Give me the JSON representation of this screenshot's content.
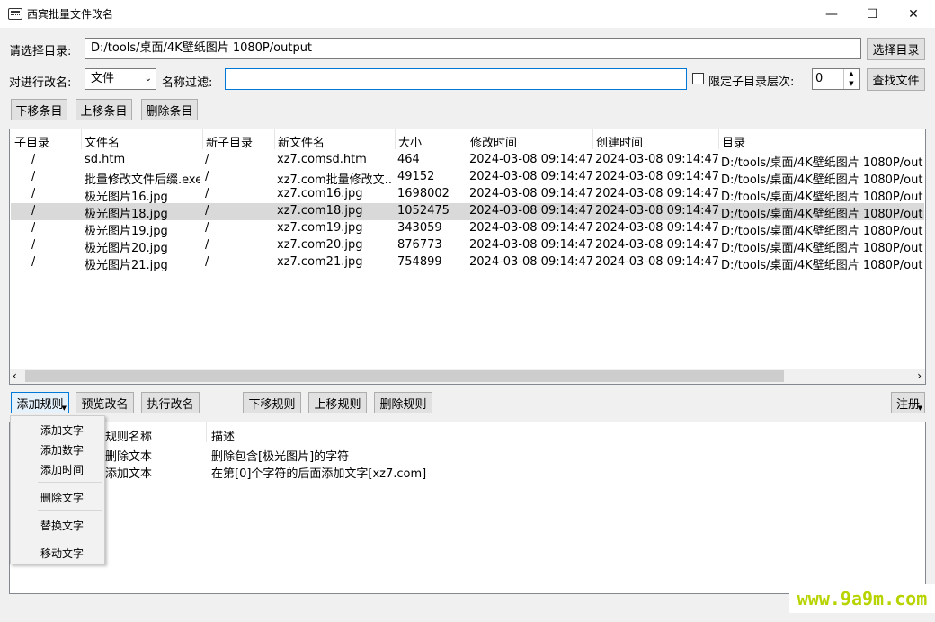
{
  "window": {
    "title": "西宾批量文件改名",
    "minimize": "—",
    "maximize": "☐",
    "close": "✕"
  },
  "toolbar": {
    "dir_label": "请选择目录:",
    "dir_value": "D:/tools/桌面/4K壁纸图片 1080P/output",
    "select_dir_button": "选择目录",
    "target_label": "对进行改名:",
    "target_value": "文件",
    "filter_label": "名称过滤:",
    "filter_value": "",
    "limit_depth_label": "限定子目录层次:",
    "limit_depth_checked": false,
    "depth_value": "0",
    "find_files_button": "查找文件",
    "move_down_button": "下移条目",
    "move_up_button": "上移条目",
    "delete_button": "删除条目"
  },
  "file_list": {
    "columns": [
      "子目录",
      "文件名",
      "新子目录",
      "新文件名",
      "大小",
      "修改时间",
      "创建时间",
      "目录"
    ],
    "rows": [
      {
        "subdir": "/",
        "name": "sd.htm",
        "new_subdir": "/",
        "new_name": "xz7.comsd.htm",
        "size": "464",
        "modified": "2024-03-08 09:14:47",
        "created": "2024-03-08 09:14:47",
        "dir": "D:/tools/桌面/4K壁纸图片 1080P/out",
        "selected": false
      },
      {
        "subdir": "/",
        "name": "批量修改文件后缀.exe",
        "new_subdir": "/",
        "new_name": "xz7.com批量修改文...",
        "size": "49152",
        "modified": "2024-03-08 09:14:47",
        "created": "2024-03-08 09:14:47",
        "dir": "D:/tools/桌面/4K壁纸图片 1080P/out",
        "selected": false
      },
      {
        "subdir": "/",
        "name": "极光图片16.jpg",
        "new_subdir": "/",
        "new_name": "xz7.com16.jpg",
        "size": "1698002",
        "modified": "2024-03-08 09:14:47",
        "created": "2024-03-08 09:14:47",
        "dir": "D:/tools/桌面/4K壁纸图片 1080P/out",
        "selected": false
      },
      {
        "subdir": "/",
        "name": "极光图片18.jpg",
        "new_subdir": "/",
        "new_name": "xz7.com18.jpg",
        "size": "1052475",
        "modified": "2024-03-08 09:14:47",
        "created": "2024-03-08 09:14:47",
        "dir": "D:/tools/桌面/4K壁纸图片 1080P/out",
        "selected": true
      },
      {
        "subdir": "/",
        "name": "极光图片19.jpg",
        "new_subdir": "/",
        "new_name": "xz7.com19.jpg",
        "size": "343059",
        "modified": "2024-03-08 09:14:47",
        "created": "2024-03-08 09:14:47",
        "dir": "D:/tools/桌面/4K壁纸图片 1080P/out",
        "selected": false
      },
      {
        "subdir": "/",
        "name": "极光图片20.jpg",
        "new_subdir": "/",
        "new_name": "xz7.com20.jpg",
        "size": "876773",
        "modified": "2024-03-08 09:14:47",
        "created": "2024-03-08 09:14:47",
        "dir": "D:/tools/桌面/4K壁纸图片 1080P/out",
        "selected": false
      },
      {
        "subdir": "/",
        "name": "极光图片21.jpg",
        "new_subdir": "/",
        "new_name": "xz7.com21.jpg",
        "size": "754899",
        "modified": "2024-03-08 09:14:47",
        "created": "2024-03-08 09:14:47",
        "dir": "D:/tools/桌面/4K壁纸图片 1080P/out",
        "selected": false
      }
    ],
    "scroll_left": "‹",
    "scroll_right": "›"
  },
  "rule_buttons": {
    "add_rule": "添加规则",
    "preview": "预览改名",
    "execute": "执行改名",
    "move_down": "下移规则",
    "move_up": "上移规则",
    "delete": "删除规则",
    "register": "注册"
  },
  "rules_list": {
    "columns": [
      "规则名称",
      "描述"
    ],
    "rows": [
      {
        "name": "删除文本",
        "desc": "删除包含[极光图片]的字符"
      },
      {
        "name": "添加文本",
        "desc": "在第[0]个字符的后面添加文字[xz7.com]"
      }
    ]
  },
  "add_rule_menu": [
    "添加文字",
    "添加数字",
    "添加时间",
    "删除文字",
    "替换文字",
    "移动文字"
  ],
  "watermark": "www.9a9m.com",
  "colors": {
    "accent": "#0078d7",
    "selected_row": "#d9d9d9",
    "watermark": "#b8d400"
  }
}
